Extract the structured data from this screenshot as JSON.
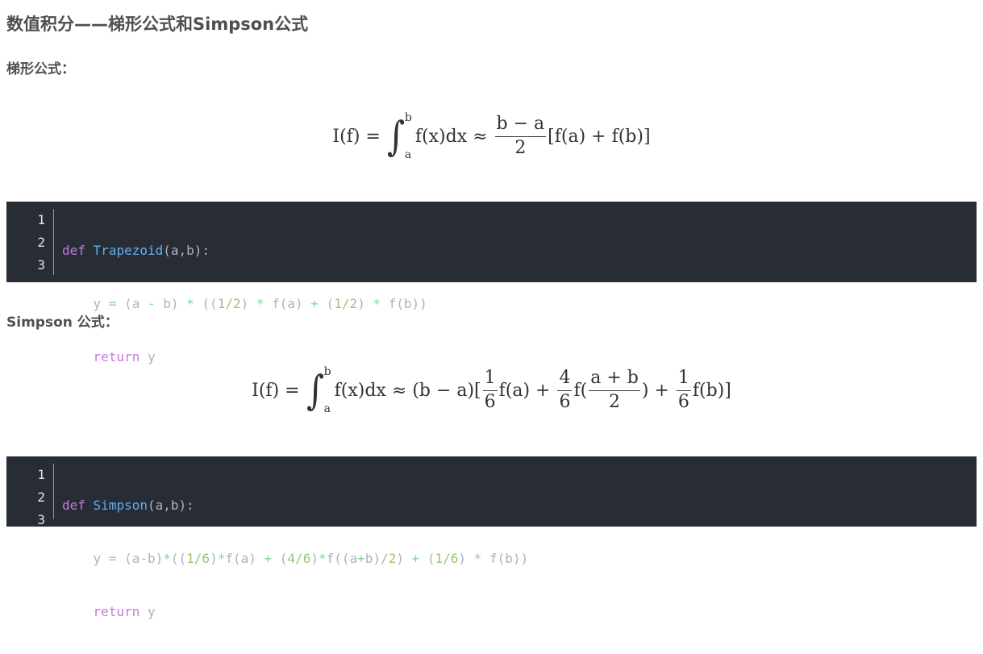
{
  "title": "数值积分——梯形公式和Simpson公式",
  "sections": {
    "trapezoid_heading": "梯形公式：",
    "simpson_heading": "Simpson 公式："
  },
  "formula_trap": {
    "lhs": "I(f) =",
    "int_upper": "b",
    "int_lower": "a",
    "integrand": "f(x)dx ≈",
    "frac_num": "b − a",
    "frac_den": "2",
    "tail": "[f(a) + f(b)]"
  },
  "formula_simpson": {
    "lhs": "I(f) =",
    "int_upper": "b",
    "int_lower": "a",
    "integrand": "f(x)dx ≈ (b − a)[",
    "f1_num": "1",
    "f1_den": "6",
    "t1": "f(a) +",
    "f2_num": "4",
    "f2_den": "6",
    "t2": "f(",
    "f3_num": "a + b",
    "f3_den": "2",
    "t3": ") +",
    "f4_num": "1",
    "f4_den": "6",
    "t4": "f(b)]"
  },
  "code_trap": {
    "line_numbers": [
      "1",
      "2",
      "3"
    ],
    "l1": {
      "kw": "def",
      "name": "Trapezoid",
      "args": "(a,b):"
    },
    "l2": {
      "indent": "    ",
      "a": "y ",
      "b": "=",
      "c": " (a ",
      "d": "-",
      "e": " b) ",
      "f": "*",
      "g": " ((",
      "h": "1/2",
      "i": ") ",
      "j": "*",
      "k": " f(a) ",
      "l": "+",
      "m": " (",
      "n": "1/2",
      "o": ") ",
      "p": "*",
      "q": " f(b))"
    },
    "l3": {
      "indent": "    ",
      "kw": "return",
      "rest": " y"
    }
  },
  "code_simpson": {
    "line_numbers": [
      "1",
      "2",
      "3"
    ],
    "l1": {
      "kw": "def",
      "name": "Simpson",
      "args": "(a,b):"
    },
    "l2": {
      "indent": "    ",
      "a": "y ",
      "b": "=",
      "c": " (a",
      "d": "-",
      "e": "b)",
      "f": "*",
      "g": "((",
      "h": "1/6",
      "i": ")",
      "j": "*",
      "k": "f(a) ",
      "l": "+",
      "m": " (",
      "n": "4/6",
      "o": ")",
      "p": "*",
      "q": "f((a",
      "r": "+",
      "s": "b)/",
      "t": "2",
      "u": ") ",
      "v": "+",
      "w": " (",
      "x": "1/6",
      "y": ") ",
      "z": "*",
      "aa": " f(b))"
    },
    "l3": {
      "indent": "    ",
      "kw": "return",
      "rest": " y"
    }
  }
}
